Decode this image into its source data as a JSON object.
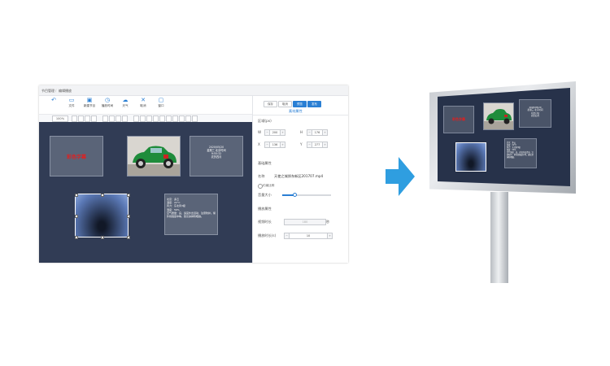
{
  "editor": {
    "breadcrumb": [
      "节目管理",
      "编辑播放"
    ],
    "toolbar": [
      {
        "label": "",
        "icon": "undo-icon"
      },
      {
        "label": "文件",
        "icon": "folder-icon"
      },
      {
        "label": "新建节目",
        "icon": "new-program-icon"
      },
      {
        "label": "播放时间",
        "icon": "clock-icon"
      },
      {
        "label": "天气",
        "icon": "weather-icon"
      },
      {
        "label": "取消",
        "icon": "close-icon"
      },
      {
        "label": "窗口",
        "icon": "window-icon"
      }
    ],
    "zoom": "100%",
    "canvas": {
      "text_widget": "彩色字幕",
      "clock_widget": [
        "2020/05/20",
        "星期三 北京时间",
        "9:55:32",
        "农历四月"
      ],
      "weather_widget": "北京：多云\n温度：22°C\n风力：东北风3级\n湿度：56%\n空气质量：良，适宜外出活动，注意防护。紫外线强度中等，建议涂抹防晒霜。"
    }
  },
  "panel": {
    "buttons": [
      "保存",
      "取消",
      "预览",
      "发布"
    ],
    "tab": "素材属性",
    "section_region": "区域(px)",
    "fields": {
      "w_label": "W",
      "w": "200",
      "h_label": "H",
      "h": "176",
      "x_label": "X",
      "x": "136",
      "y_label": "Y",
      "y": "277"
    },
    "section_basic": "基础属性",
    "name_label": "名称",
    "name_value": "天使之城郑东新区201707.mp4",
    "keep_ratio": "约束比例",
    "volume_label": "音量大小",
    "volume": 0.25,
    "section_play": "播放属性",
    "duration_label": "视频时长",
    "duration_value": "180",
    "duration_unit": "秒",
    "play_count_label": "播放时长(s)",
    "play_count": "10"
  },
  "colors": {
    "accent": "#2a7fd4",
    "canvas": "#313c55",
    "arrow": "#2f9ee0",
    "text_red": "#e02020"
  }
}
